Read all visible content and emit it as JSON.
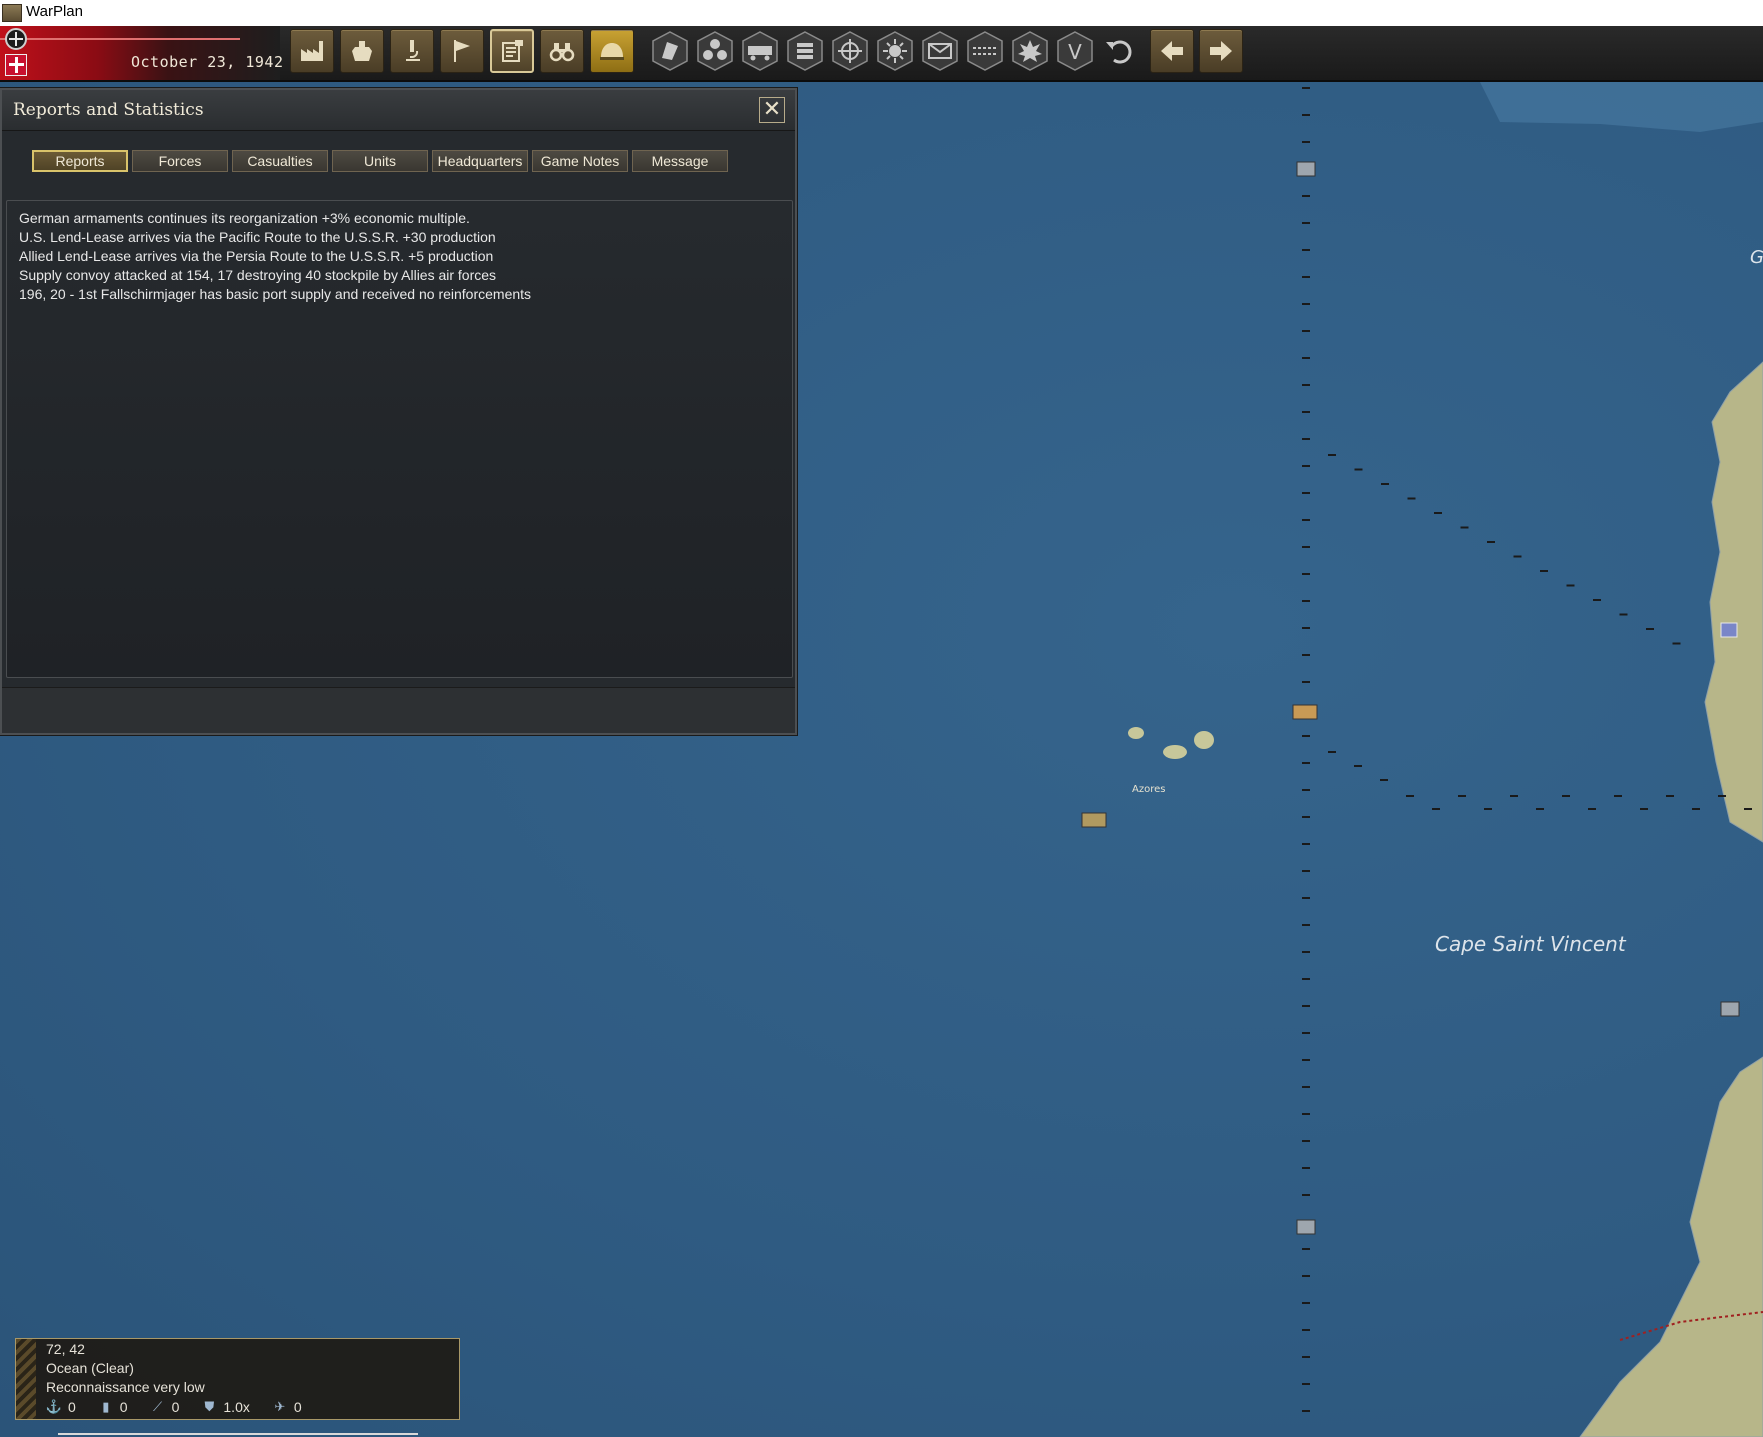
{
  "window": {
    "title": "WarPlan"
  },
  "toolbar": {
    "date": "October 23, 1942",
    "buttons": [
      {
        "icon": "factory-icon"
      },
      {
        "icon": "ship-icon"
      },
      {
        "icon": "microscope-icon"
      },
      {
        "icon": "flag-icon"
      },
      {
        "icon": "reports-icon"
      },
      {
        "icon": "binoculars-icon"
      },
      {
        "icon": "helmet-icon"
      },
      {
        "icon": "hex-terrain-icon"
      },
      {
        "icon": "hex-cluster-icon"
      },
      {
        "icon": "rail-icon"
      },
      {
        "icon": "coins-icon"
      },
      {
        "icon": "crosshair-icon"
      },
      {
        "icon": "sun-icon"
      },
      {
        "icon": "envelope-icon"
      },
      {
        "icon": "lines-icon"
      },
      {
        "icon": "explosion-icon"
      },
      {
        "icon": "victory-icon"
      },
      {
        "icon": "undo-icon"
      },
      {
        "icon": "arrow-left-icon"
      },
      {
        "icon": "arrow-right-icon"
      }
    ],
    "victory_glyph": "V"
  },
  "dialog": {
    "title": "Reports and Statistics",
    "close_glyph": "✕",
    "tabs": [
      {
        "label": "Reports",
        "active": true
      },
      {
        "label": "Forces"
      },
      {
        "label": "Casualties"
      },
      {
        "label": "Units"
      },
      {
        "label": "Headquarters"
      },
      {
        "label": "Game Notes"
      },
      {
        "label": "Message"
      }
    ],
    "reports": [
      "German armaments continues its reorganization +3% economic multiple.",
      "U.S. Lend-Lease arrives via the Pacific Route to the U.S.S.R. +30 production",
      "Allied Lend-Lease arrives via the Persia Route to the U.S.S.R. +5 production",
      "Supply convoy attacked at 154, 17 destroying 40 stockpile by Allies air forces",
      "196, 20 - 1st Fallschirmjager has basic port supply and received no reinforcements"
    ]
  },
  "map": {
    "labels": {
      "azores": "Azores",
      "cape": "Cape Saint Vincent",
      "edge": "G"
    }
  },
  "infobox": {
    "coords": "72, 42",
    "terrain": "Ocean (Clear)",
    "recon": "Reconnaissance very low",
    "stats": [
      {
        "icon": "anchor-icon",
        "value": "0"
      },
      {
        "icon": "supply-icon",
        "value": "0"
      },
      {
        "icon": "artillery-icon",
        "value": "0"
      },
      {
        "icon": "shield-icon",
        "value": "1.0x"
      },
      {
        "icon": "aircraft-icon",
        "value": "0"
      }
    ]
  },
  "colors": {
    "ocean": "#2f5b82",
    "land": "#b7b689",
    "accent": "#d9c36a",
    "nation_red": "#c0101a"
  }
}
